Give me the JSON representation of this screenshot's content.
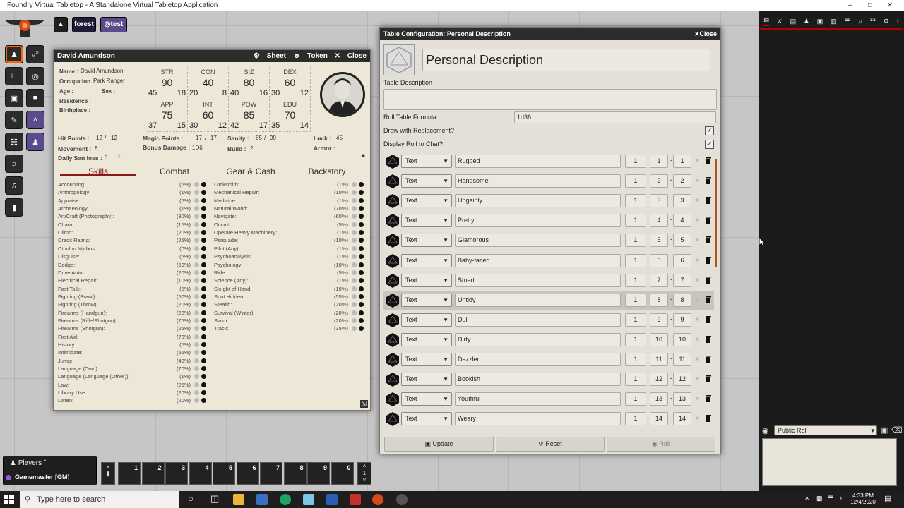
{
  "window": {
    "title": "Foundry Virtual Tabletop - A Standalone Virtual Tabletop Application"
  },
  "nav": {
    "scene1": "forest",
    "scene2": "test"
  },
  "actor": {
    "header": "David Amundson",
    "controls": {
      "sheet": "Sheet",
      "token": "Token",
      "close": "Close"
    },
    "fields": [
      {
        "label": "Name :",
        "value": "David Amundson"
      },
      {
        "label": "Occupation :",
        "value": "Park Ranger"
      },
      {
        "label": "Age :",
        "value": ""
      },
      {
        "label": "Sex :",
        "value": ""
      },
      {
        "label": "Residence :",
        "value": ""
      },
      {
        "label": "Birthplace :",
        "value": ""
      }
    ],
    "characteristics": [
      {
        "name": "STR",
        "value": "90",
        "half": "45",
        "fifth": "18"
      },
      {
        "name": "CON",
        "value": "40",
        "half": "20",
        "fifth": "8"
      },
      {
        "name": "SIZ",
        "value": "80",
        "half": "40",
        "fifth": "16"
      },
      {
        "name": "DEX",
        "value": "60",
        "half": "30",
        "fifth": "12"
      },
      {
        "name": "APP",
        "value": "75",
        "half": "37",
        "fifth": "15"
      },
      {
        "name": "INT",
        "value": "60",
        "half": "30",
        "fifth": "12"
      },
      {
        "name": "POW",
        "value": "85",
        "half": "42",
        "fifth": "17"
      },
      {
        "name": "EDU",
        "value": "70",
        "half": "35",
        "fifth": "14"
      }
    ],
    "stats": {
      "hp_label": "Hit Points :",
      "hp": "12",
      "hp_max": "12",
      "mp_label": "Magic Points :",
      "mp": "17",
      "mp_max": "17",
      "san_label": "Sanity :",
      "san": "85",
      "san_max": "99",
      "luck_label": "Luck :",
      "luck": "45",
      "move_label": "Movement :",
      "move": "8",
      "db_label": "Bonus Damage :",
      "db": "1D6",
      "build_label": "Build :",
      "build": "2",
      "armor_label": "Armor :",
      "dsl_label": "Daily San loss :",
      "dsl": "0"
    },
    "tabs": [
      "Skills",
      "Combat",
      "Gear & Cash",
      "Backstory"
    ],
    "skills_left": [
      [
        "Accounting:",
        "(5%)"
      ],
      [
        "Anthropology:",
        "(1%)"
      ],
      [
        "Appraise:",
        "(5%)"
      ],
      [
        "Archaeology:",
        "(1%)"
      ],
      [
        "Art/Craft (Photography):",
        "(30%)"
      ],
      [
        "Charm:",
        "(15%)"
      ],
      [
        "Climb:",
        "(20%)"
      ],
      [
        "Credit Rating:",
        "(25%)"
      ],
      [
        "Cthulhu Mythos:",
        "(0%)"
      ],
      [
        "Disguise:",
        "(5%)"
      ],
      [
        "Dodge:",
        "(50%)"
      ],
      [
        "Drive Auto:",
        "(20%)"
      ],
      [
        "Electrical Repair:",
        "(10%)"
      ],
      [
        "Fast Talk:",
        "(5%)"
      ],
      [
        "Fighting (Brawl):",
        "(50%)"
      ],
      [
        "Fighting (Throw):",
        "(20%)"
      ],
      [
        "Firearms (Handgun):",
        "(20%)"
      ],
      [
        "Firearms (Rifle/Shotgun):",
        "(75%)"
      ],
      [
        "Firearms (Shotgun):",
        "(25%)"
      ],
      [
        "First Aid:",
        "(70%)"
      ],
      [
        "History:",
        "(5%)"
      ],
      [
        "Intimidate:",
        "(55%)"
      ],
      [
        "Jump:",
        "(40%)"
      ],
      [
        "Language (Own):",
        "(70%)"
      ],
      [
        "Language (Language (Other)):",
        "(1%)"
      ],
      [
        "Law:",
        "(25%)"
      ],
      [
        "Library Use:",
        "(20%)"
      ],
      [
        "Listen:",
        "(20%)"
      ]
    ],
    "skills_right": [
      [
        "Locksmith:",
        "(1%)"
      ],
      [
        "Mechanical Repair:",
        "(10%)"
      ],
      [
        "Medicine:",
        "(1%)"
      ],
      [
        "Natural World:",
        "(70%)"
      ],
      [
        "Navigate:",
        "(60%)"
      ],
      [
        "Occult:",
        "(5%)"
      ],
      [
        "Operate Heavy Machinery:",
        "(1%)"
      ],
      [
        "Persuade:",
        "(10%)"
      ],
      [
        "Pilot (Any):",
        "(1%)"
      ],
      [
        "Psychoanalysis:",
        "(1%)"
      ],
      [
        "Psychology:",
        "(10%)"
      ],
      [
        "Ride:",
        "(5%)"
      ],
      [
        "Science (Any):",
        "(1%)"
      ],
      [
        "Sleight of Hand:",
        "(10%)"
      ],
      [
        "Spot Hidden:",
        "(55%)"
      ],
      [
        "Stealth:",
        "(20%)"
      ],
      [
        "Survival (Winter):",
        "(20%)"
      ],
      [
        "Swim:",
        "(20%)"
      ],
      [
        "Track:",
        "(35%)"
      ]
    ]
  },
  "dialog": {
    "header": "Table Configuration: Personal Description",
    "close": "Close",
    "name": "Personal Description",
    "desc_label": "Table Description",
    "formula_label": "Roll Table Formula",
    "formula": "1d36",
    "replacement_label": "Draw with Replacement?",
    "display_label": "Display Roll to Chat?",
    "results": [
      {
        "type": "Text",
        "text": "Rugged",
        "weight": "1",
        "lo": "1",
        "hi": "1"
      },
      {
        "type": "Text",
        "text": "Handsome",
        "weight": "1",
        "lo": "2",
        "hi": "2"
      },
      {
        "type": "Text",
        "text": "Ungainly",
        "weight": "1",
        "lo": "3",
        "hi": "3"
      },
      {
        "type": "Text",
        "text": "Pretty",
        "weight": "1",
        "lo": "4",
        "hi": "4"
      },
      {
        "type": "Text",
        "text": "Glamorous",
        "weight": "1",
        "lo": "5",
        "hi": "5"
      },
      {
        "type": "Text",
        "text": "Baby-faced",
        "weight": "1",
        "lo": "6",
        "hi": "6"
      },
      {
        "type": "Text",
        "text": "Smart",
        "weight": "1",
        "lo": "7",
        "hi": "7"
      },
      {
        "type": "Text",
        "text": "Untidy",
        "weight": "1",
        "lo": "8",
        "hi": "8"
      },
      {
        "type": "Text",
        "text": "Dull",
        "weight": "1",
        "lo": "9",
        "hi": "9"
      },
      {
        "type": "Text",
        "text": "Dirty",
        "weight": "1",
        "lo": "10",
        "hi": "10"
      },
      {
        "type": "Text",
        "text": "Dazzler",
        "weight": "1",
        "lo": "11",
        "hi": "11"
      },
      {
        "type": "Text",
        "text": "Bookish",
        "weight": "1",
        "lo": "12",
        "hi": "12"
      },
      {
        "type": "Text",
        "text": "Youthful",
        "weight": "1",
        "lo": "13",
        "hi": "13"
      },
      {
        "type": "Text",
        "text": "Weary",
        "weight": "1",
        "lo": "14",
        "hi": "14"
      }
    ],
    "buttons": {
      "update": "Update",
      "reset": "Reset",
      "roll": "Roll"
    }
  },
  "sidebar": {
    "roll_mode": "Public Roll"
  },
  "players": {
    "title": "Players",
    "gm": "Gamemaster [GM]"
  },
  "hotbar": {
    "slots": [
      "1",
      "2",
      "3",
      "4",
      "5",
      "6",
      "7",
      "8",
      "9",
      "0"
    ],
    "page": "1"
  },
  "taskbar": {
    "search": "Type here to search",
    "time": "4:33 PM",
    "date": "12/4/2020"
  }
}
